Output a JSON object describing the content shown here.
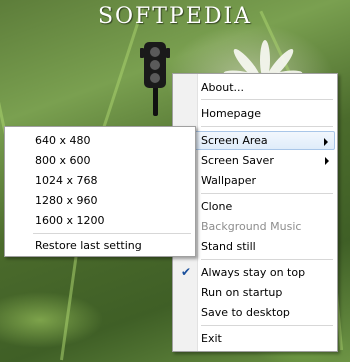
{
  "watermark": {
    "text": "SOFTPEDIA"
  },
  "icons": {
    "app": "traffic-light-icon",
    "check": "checkmark-icon",
    "submenu": "chevron-right-icon"
  },
  "context_menu": {
    "items": [
      {
        "label": "About..."
      },
      {
        "label": "Homepage"
      },
      {
        "label": "Screen Area",
        "submenu": true,
        "highlighted": true
      },
      {
        "label": "Screen Saver",
        "submenu": true
      },
      {
        "label": "Wallpaper"
      },
      {
        "label": "Clone"
      },
      {
        "label": "Background Music",
        "disabled": true
      },
      {
        "label": "Stand still"
      },
      {
        "label": "Always stay on top",
        "checked": true
      },
      {
        "label": "Run on startup"
      },
      {
        "label": "Save to desktop"
      },
      {
        "label": "Exit"
      }
    ]
  },
  "screen_area_submenu": {
    "items": [
      {
        "label": "640 x 480"
      },
      {
        "label": "800 x 600"
      },
      {
        "label": "1024 x 768"
      },
      {
        "label": "1280 x 960"
      },
      {
        "label": "1600 x 1200"
      },
      {
        "label": "Restore last setting"
      }
    ]
  }
}
